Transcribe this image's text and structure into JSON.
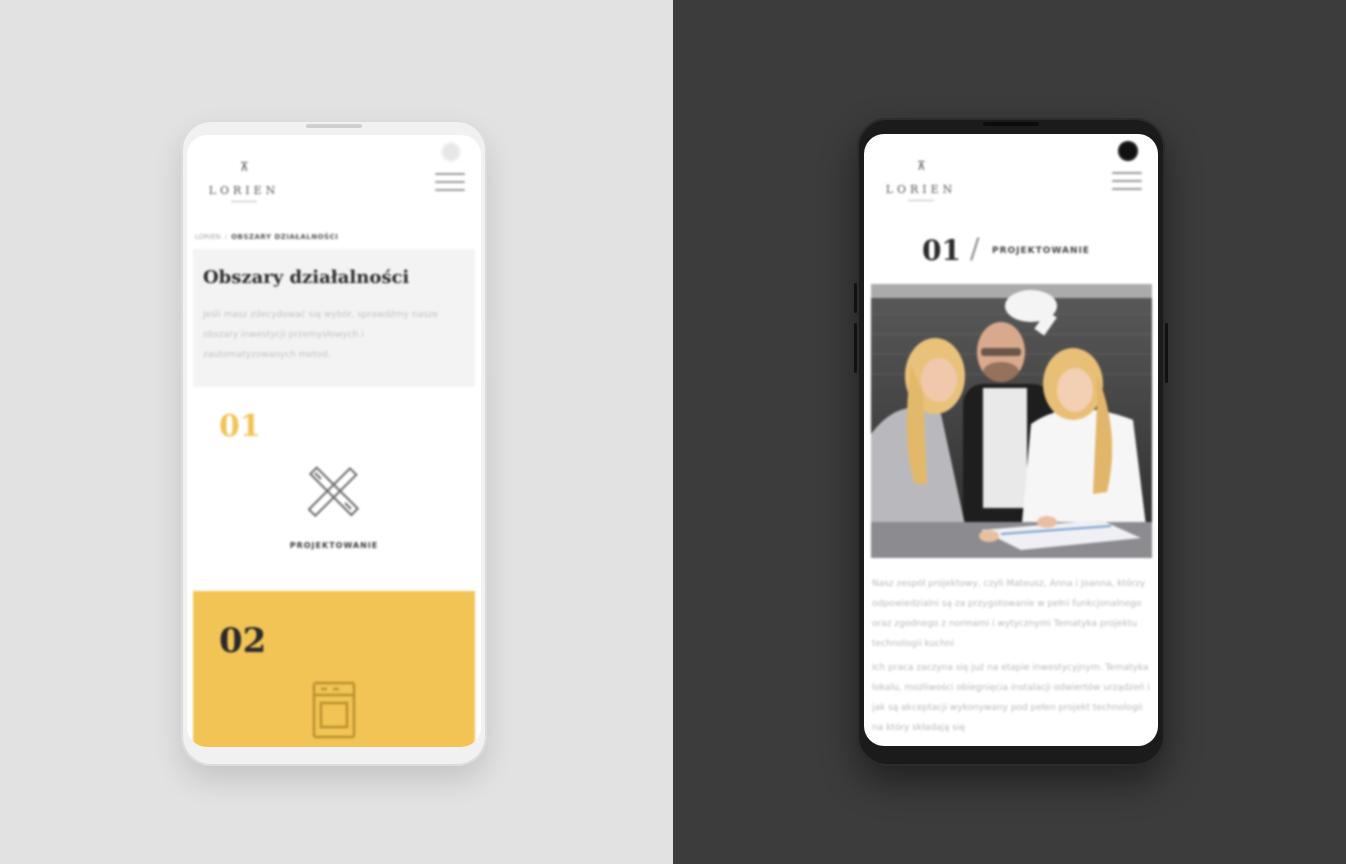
{
  "left_phone": {
    "logo": {
      "text": "LORIEN",
      "icon": "lamp-logo-icon"
    },
    "menu_icon": "hamburger-menu-icon",
    "breadcrumb": {
      "home": "LORIEN",
      "separator": "/",
      "current": "OBSZARY DZIAŁALNOŚCI"
    },
    "intro": {
      "title": "Obszary działalności",
      "text": "Jeśli masz zdecydować się wybór, sprawdźmy nasze obszary inwestycji przemysłowych i zautomatyzowanych metod."
    },
    "cards": [
      {
        "number": "01",
        "label": "PROJEKTOWANIE",
        "icon": "pencil-ruler-icon",
        "color": "#f2c455"
      },
      {
        "number": "02",
        "label": "",
        "icon": "stove-icon",
        "color": "#f2c455"
      }
    ]
  },
  "right_phone": {
    "logo": {
      "text": "LORIEN",
      "icon": "lamp-logo-icon"
    },
    "menu_icon": "hamburger-menu-icon",
    "section": {
      "number": "01",
      "slash": "/",
      "label": "PROJEKTOWANIE"
    },
    "photo": {
      "alt": "team-meeting-photo"
    },
    "paragraphs": [
      "Nasz zespół projektowy, czyli Mateusz, Anna i Joanna, którzy odpowiedzialni są za przygotowanie w pełni funkcjonalnego oraz zgodnego z normami i wytycznymi Tematyka projektu technologii kuchni",
      "Ich praca zaczyna się już na etapie inwestycyjnym. Tematyka lokalu, możliwości obiegnięcia instalacji odwiertów urządzeń i jak są akceptacji wykonywany pod pełen projekt technologii na który składają się"
    ]
  },
  "colors": {
    "accent_yellow": "#f2c455",
    "left_background": "#e2e2e2",
    "right_background": "#3c3c3c"
  }
}
